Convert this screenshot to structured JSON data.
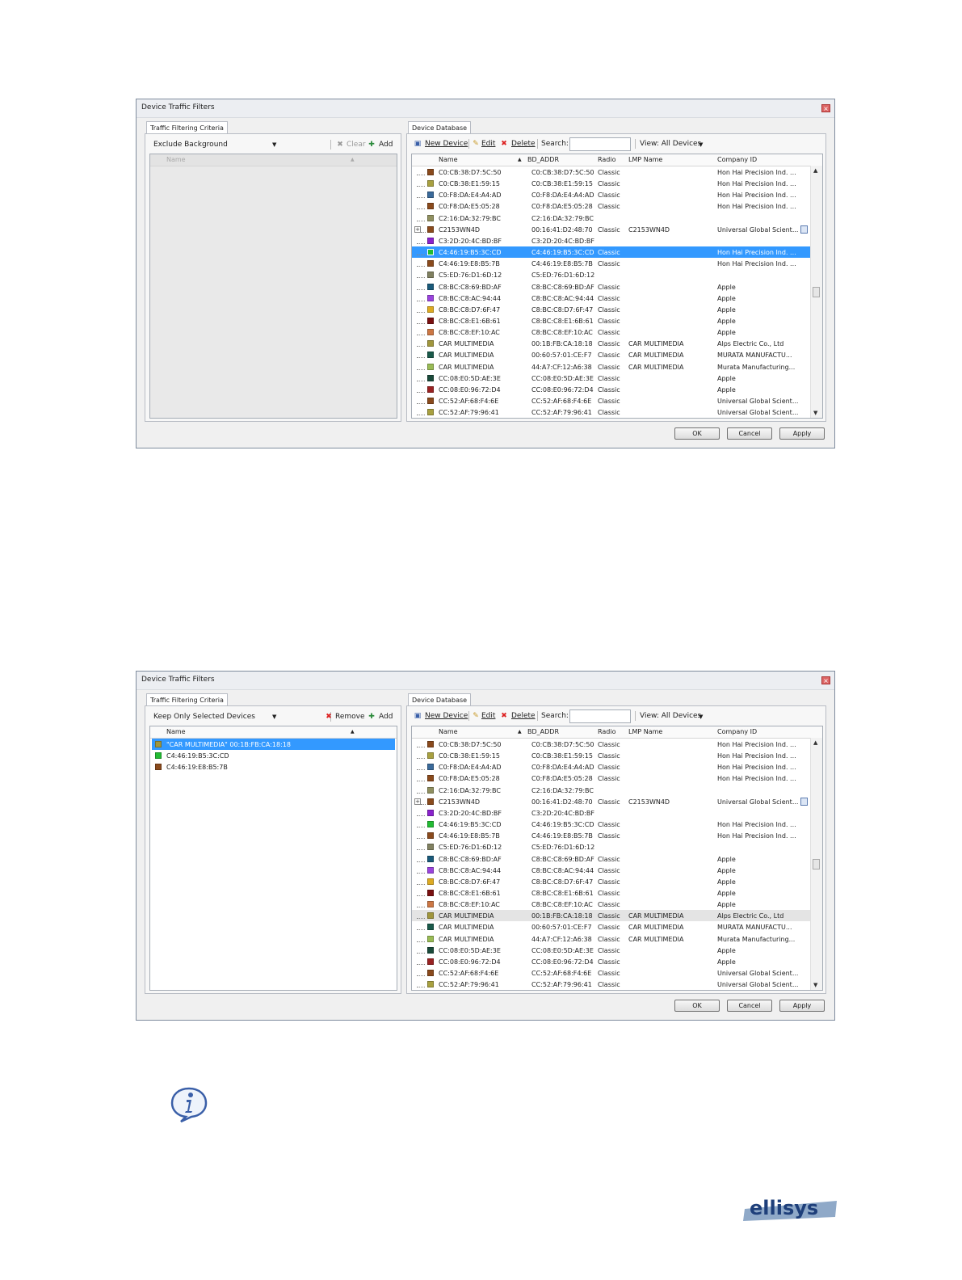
{
  "dialogs": [
    {
      "title": "Device Traffic Filters",
      "left_tab": "Traffic Filtering Criteria",
      "criteria_dropdown": "Exclude Background",
      "left_button_1": "Clear",
      "left_button_2": "Add",
      "left_list_header": "Name",
      "left_list_enabled": false,
      "left_items": [],
      "right_tab": "Device Database",
      "new_device": "New Device",
      "edit": "Edit",
      "delete": "Delete",
      "search_label": "Search:",
      "search_value": "",
      "view": "View: All Devices",
      "columns": [
        "Name",
        "BD_ADDR",
        "Radio",
        "LMP Name",
        "Company ID"
      ],
      "selected_row": 7,
      "hover_row": -1,
      "ok": "OK",
      "cancel": "Cancel",
      "apply": "Apply"
    },
    {
      "title": "Device Traffic Filters",
      "left_tab": "Traffic Filtering Criteria",
      "criteria_dropdown": "Keep Only Selected Devices",
      "left_button_1": "Remove",
      "left_button_2": "Add",
      "left_list_header": "Name",
      "left_list_enabled": true,
      "left_items": [
        {
          "name": "\"CAR MULTIMEDIA\" 00:1B:FB:CA:18:18",
          "color": "#a0963c",
          "selected": true
        },
        {
          "name": "C4:46:19:B5:3C:CD",
          "color": "#22bb33",
          "selected": false
        },
        {
          "name": "C4:46:19:E8:B5:7B",
          "color": "#8a4a1c",
          "selected": false
        }
      ],
      "right_tab": "Device Database",
      "new_device": "New Device",
      "edit": "Edit",
      "delete": "Delete",
      "search_label": "Search:",
      "search_value": "",
      "view": "View: All Devices",
      "columns": [
        "Name",
        "BD_ADDR",
        "Radio",
        "LMP Name",
        "Company ID"
      ],
      "selected_row": -1,
      "hover_row": 15,
      "ok": "OK",
      "cancel": "Cancel",
      "apply": "Apply"
    }
  ],
  "devices": [
    {
      "name": "C0:CB:38:D7:5C:50",
      "addr": "C0:CB:38:D7:5C:50",
      "radio": "Classic",
      "lmp": "",
      "company": "Hon Hai Precision Ind. ...",
      "color": "#8a4a1c",
      "expandable": false
    },
    {
      "name": "C0:CB:38:E1:59:15",
      "addr": "C0:CB:38:E1:59:15",
      "radio": "Classic",
      "lmp": "",
      "company": "Hon Hai Precision Ind. ...",
      "color": "#a8a040",
      "expandable": false
    },
    {
      "name": "C0:F8:DA:E4:A4:AD",
      "addr": "C0:F8:DA:E4:A4:AD",
      "radio": "Classic",
      "lmp": "",
      "company": "Hon Hai Precision Ind. ...",
      "color": "#3a6a9a",
      "expandable": false
    },
    {
      "name": "C0:F8:DA:E5:05:28",
      "addr": "C0:F8:DA:E5:05:28",
      "radio": "Classic",
      "lmp": "",
      "company": "Hon Hai Precision Ind. ...",
      "color": "#8a4a1c",
      "expandable": false
    },
    {
      "name": "C2:16:DA:32:79:BC",
      "addr": "C2:16:DA:32:79:BC",
      "radio": "",
      "lmp": "",
      "company": "",
      "color": "#909060",
      "expandable": false
    },
    {
      "name": "C2153WN4D",
      "addr": "00:16:41:D2:48:70",
      "radio": "Classic",
      "lmp": "C2153WN4D",
      "company": "Universal Global Scient...",
      "color": "#8a4a1c",
      "expandable": true
    },
    {
      "name": "C3:2D:20:4C:BD:BF",
      "addr": "C3:2D:20:4C:BD:BF",
      "radio": "",
      "lmp": "",
      "company": "",
      "color": "#8a22cc",
      "expandable": false
    },
    {
      "name": "C4:46:19:B5:3C:CD",
      "addr": "C4:46:19:B5:3C:CD",
      "radio": "Classic",
      "lmp": "",
      "company": "Hon Hai Precision Ind. ...",
      "color": "#22bb33",
      "expandable": false
    },
    {
      "name": "C4:46:19:E8:B5:7B",
      "addr": "C4:46:19:E8:B5:7B",
      "radio": "Classic",
      "lmp": "",
      "company": "Hon Hai Precision Ind. ...",
      "color": "#8a4a1c",
      "expandable": false
    },
    {
      "name": "C5:ED:76:D1:6D:12",
      "addr": "C5:ED:76:D1:6D:12",
      "radio": "",
      "lmp": "",
      "company": "",
      "color": "#808060",
      "expandable": false
    },
    {
      "name": "C8:BC:C8:69:BD:AF",
      "addr": "C8:BC:C8:69:BD:AF",
      "radio": "Classic",
      "lmp": "",
      "company": "Apple",
      "color": "#1a5a7a",
      "expandable": false
    },
    {
      "name": "C8:BC:C8:AC:94:44",
      "addr": "C8:BC:C8:AC:94:44",
      "radio": "Classic",
      "lmp": "",
      "company": "Apple",
      "color": "#9a44dd",
      "expandable": false
    },
    {
      "name": "C8:BC:C8:D7:6F:47",
      "addr": "C8:BC:C8:D7:6F:47",
      "radio": "Classic",
      "lmp": "",
      "company": "Apple",
      "color": "#ddaa22",
      "expandable": false
    },
    {
      "name": "C8:BC:C8:E1:6B:61",
      "addr": "C8:BC:C8:E1:6B:61",
      "radio": "Classic",
      "lmp": "",
      "company": "Apple",
      "color": "#7a1010",
      "expandable": false
    },
    {
      "name": "C8:BC:C8:EF:10:AC",
      "addr": "C8:BC:C8:EF:10:AC",
      "radio": "Classic",
      "lmp": "",
      "company": "Apple",
      "color": "#cc7744",
      "expandable": false
    },
    {
      "name": "CAR MULTIMEDIA",
      "addr": "00:1B:FB:CA:18:18",
      "radio": "Classic",
      "lmp": "CAR MULTIMEDIA",
      "company": "Alps Electric Co., Ltd",
      "color": "#a0963c",
      "expandable": false
    },
    {
      "name": "CAR MULTIMEDIA",
      "addr": "00:60:57:01:CE:F7",
      "radio": "Classic",
      "lmp": "CAR MULTIMEDIA",
      "company": "MURATA MANUFACTU...",
      "color": "#1a5a4a",
      "expandable": false
    },
    {
      "name": "CAR MULTIMEDIA",
      "addr": "44:A7:CF:12:A6:38",
      "radio": "Classic",
      "lmp": "CAR MULTIMEDIA",
      "company": "Murata Manufacturing...",
      "color": "#99bb55",
      "expandable": false
    },
    {
      "name": "CC:08:E0:5D:AE:3E",
      "addr": "CC:08:E0:5D:AE:3E",
      "radio": "Classic",
      "lmp": "",
      "company": "Apple",
      "color": "#1a4a3a",
      "expandable": false
    },
    {
      "name": "CC:08:E0:96:72:D4",
      "addr": "CC:08:E0:96:72:D4",
      "radio": "Classic",
      "lmp": "",
      "company": "Apple",
      "color": "#992222",
      "expandable": false
    },
    {
      "name": "CC:52:AF:68:F4:6E",
      "addr": "CC:52:AF:68:F4:6E",
      "radio": "Classic",
      "lmp": "",
      "company": "Universal Global Scient...",
      "color": "#8a4a1c",
      "expandable": false
    },
    {
      "name": "CC:52:AF:79:96:41",
      "addr": "CC:52:AF:79:96:41",
      "radio": "Classic",
      "lmp": "",
      "company": "Universal Global Scient...",
      "color": "#a8a040",
      "expandable": false
    }
  ],
  "logo_text": "ellisys",
  "info_icon": "info-speech-bubble-icon"
}
